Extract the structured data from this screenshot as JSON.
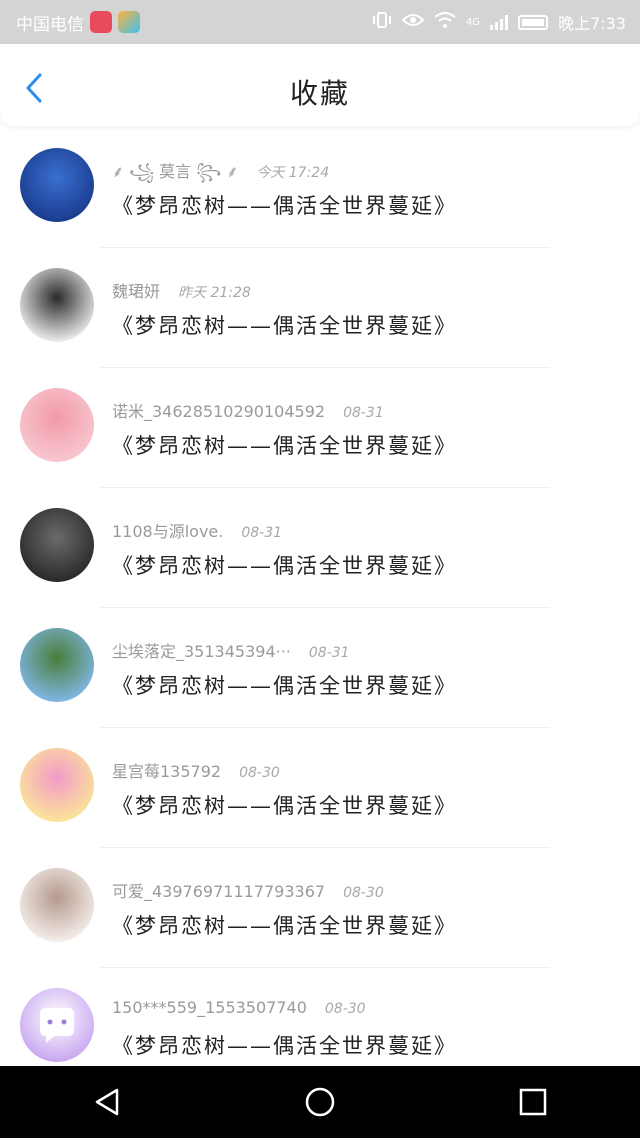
{
  "status_bar": {
    "carrier": "中国电信",
    "network": "4G",
    "time": "晚上7:33"
  },
  "header": {
    "title": "收藏"
  },
  "favorites": [
    {
      "user": "⸙ ꧁ 莫言 ꧂ ⸙",
      "time": "今天 17:24",
      "content": "《梦昂恋树——偶活全世界蔓延》",
      "avatar_colors": [
        "#1b3d8f",
        "#3a6fd1"
      ]
    },
    {
      "user": "魏珺妍",
      "time": "昨天 21:28",
      "content": "《梦昂恋树——偶活全世界蔓延》",
      "avatar_colors": [
        "#e8e8e8",
        "#2b2b2b"
      ]
    },
    {
      "user": "诺米_34628510290104592",
      "time": "08-31",
      "content": "《梦昂恋树——偶活全世界蔓延》",
      "avatar_colors": [
        "#f7c6cf",
        "#f29aa8"
      ]
    },
    {
      "user": "1108与源love.",
      "time": "08-31",
      "content": "《梦昂恋树——偶活全世界蔓延》",
      "avatar_colors": [
        "#2b2b2b",
        "#6b6b6b"
      ]
    },
    {
      "user": "尘埃落定_351345394···",
      "time": "08-31",
      "content": "《梦昂恋树——偶活全世界蔓延》",
      "avatar_colors": [
        "#7fb5e0",
        "#4a7d3a"
      ]
    },
    {
      "user": "星宫莓135792",
      "time": "08-30",
      "content": "《梦昂恋树——偶活全世界蔓延》",
      "avatar_colors": [
        "#fbe39a",
        "#f29ac8"
      ]
    },
    {
      "user": "可爱_43976971117793367",
      "time": "08-30",
      "content": "《梦昂恋树——偶活全世界蔓延》",
      "avatar_colors": [
        "#f3ece8",
        "#b59a8e"
      ]
    },
    {
      "user": "150***559_1553507740",
      "time": "08-30",
      "content": "《梦昂恋树——偶活全世界蔓延》",
      "avatar_colors": [
        "#c9a8f0",
        "#ffffff"
      ]
    }
  ],
  "accent_color": "#2d8cf0"
}
